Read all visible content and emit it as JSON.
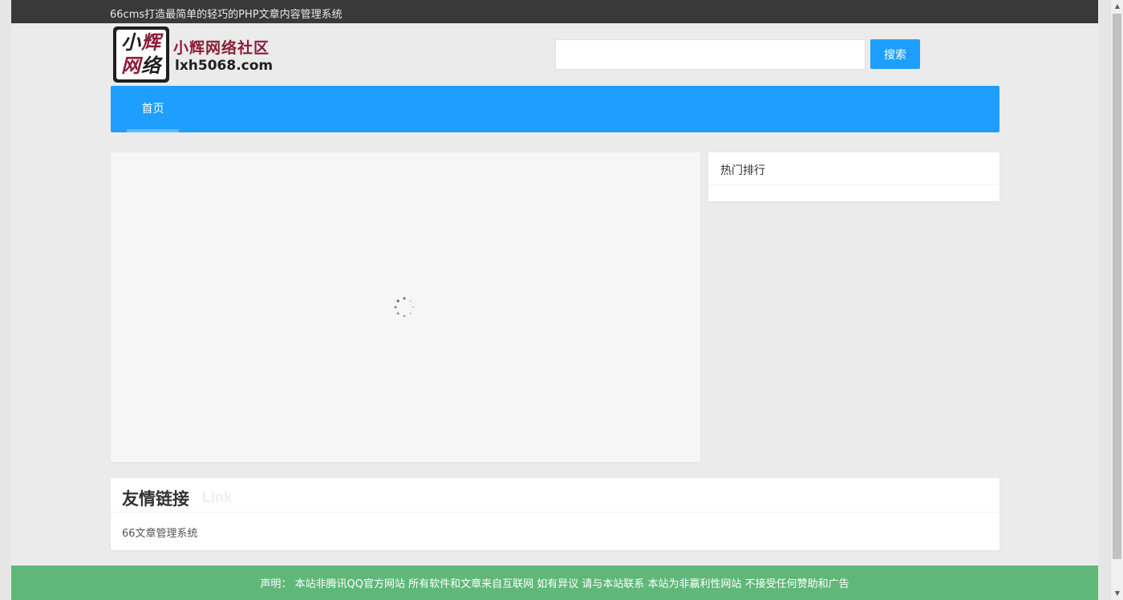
{
  "topbar": {
    "tagline": "66cms打造最简单的轻巧的PHP文章内容管理系统"
  },
  "header": {
    "logo_chars": [
      "小",
      "辉",
      "网",
      "络"
    ],
    "site_name": "小辉网络社区",
    "site_domain": "lxh5068.com",
    "search": {
      "value": "",
      "placeholder": "",
      "button_label": "搜索"
    }
  },
  "nav": {
    "items": [
      {
        "label": "首页",
        "active": true
      }
    ]
  },
  "sidebar": {
    "hot_title": "热门排行"
  },
  "friend_links": {
    "title": "友情链接",
    "subtitle": "Link",
    "items": [
      {
        "label": "66文章管理系统"
      }
    ]
  },
  "footer": {
    "statement": "声明： 本站非腾讯QQ官方网站 所有软件和文章来自互联网 如有异议 请与本站联系 本站为非赢利性网站 不接受任何赞助和广告"
  },
  "colors": {
    "accent_blue": "#1e9fff",
    "footer_green": "#5fb878",
    "topbar_dark": "#393939",
    "logo_red": "#8b1d3a"
  }
}
